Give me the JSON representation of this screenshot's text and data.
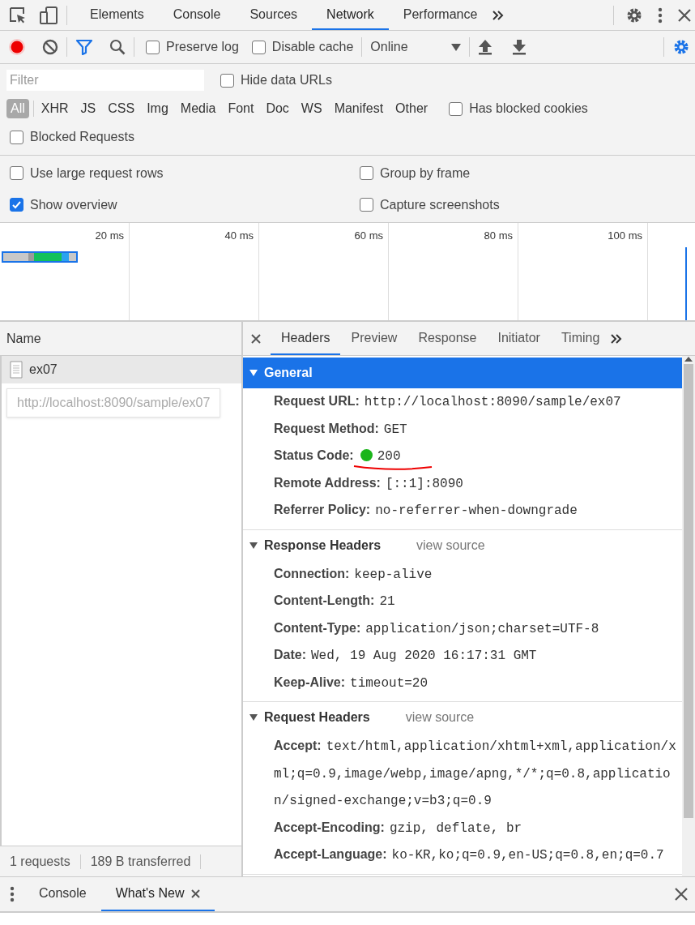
{
  "top_tabs": [
    {
      "label": "Elements",
      "selected": false
    },
    {
      "label": "Console",
      "selected": false
    },
    {
      "label": "Sources",
      "selected": false
    },
    {
      "label": "Network",
      "selected": true
    },
    {
      "label": "Performance",
      "selected": false
    }
  ],
  "toolbar": {
    "recording": true,
    "filter_active": true,
    "checkboxes": [
      {
        "label": "Preserve log",
        "checked": false
      },
      {
        "label": "Disable cache",
        "checked": false
      }
    ],
    "throttle": "Online"
  },
  "filter": {
    "placeholder": "Filter",
    "hide_data_urls": {
      "label": "Hide data URLs",
      "checked": false
    }
  },
  "types": [
    {
      "label": "All",
      "selected": true
    },
    {
      "label": "XHR",
      "selected": false
    },
    {
      "label": "JS",
      "selected": false
    },
    {
      "label": "CSS",
      "selected": false
    },
    {
      "label": "Img",
      "selected": false
    },
    {
      "label": "Media",
      "selected": false
    },
    {
      "label": "Font",
      "selected": false
    },
    {
      "label": "Doc",
      "selected": false
    },
    {
      "label": "WS",
      "selected": false
    },
    {
      "label": "Manifest",
      "selected": false
    },
    {
      "label": "Other",
      "selected": false
    }
  ],
  "has_blocked_cookies": {
    "label": "Has blocked cookies",
    "checked": false
  },
  "blocked_requests": {
    "label": "Blocked Requests",
    "checked": false
  },
  "settings": [
    {
      "label": "Use large request rows",
      "checked": false
    },
    {
      "label": "Group by frame",
      "checked": false
    },
    {
      "label": "Show overview",
      "checked": true
    },
    {
      "label": "Capture screenshots",
      "checked": false
    }
  ],
  "overview": {
    "ticks": [
      "20 ms",
      "40 ms",
      "60 ms",
      "80 ms",
      "100 ms"
    ]
  },
  "requests": {
    "column": "Name",
    "rows": [
      {
        "name": "ex07",
        "selected": true
      }
    ],
    "tooltip": "http://localhost:8090/sample/ex07"
  },
  "detail_tabs": [
    {
      "label": "Headers",
      "selected": true
    },
    {
      "label": "Preview",
      "selected": false
    },
    {
      "label": "Response",
      "selected": false
    },
    {
      "label": "Initiator",
      "selected": false
    },
    {
      "label": "Timing",
      "selected": false
    }
  ],
  "sections": [
    {
      "title": "General",
      "expanded": true,
      "highlighted": true,
      "rows": [
        {
          "key": "Request URL:",
          "value": "http://localhost:8090/sample/ex07"
        },
        {
          "key": "Request Method:",
          "value": "GET"
        },
        {
          "key": "Status Code:",
          "value": "200",
          "kind": "status",
          "underlined": true
        },
        {
          "key": "Remote Address:",
          "value": "[::1]:8090"
        },
        {
          "key": "Referrer Policy:",
          "value": "no-referrer-when-downgrade"
        }
      ]
    },
    {
      "title": "Response Headers",
      "link": "view source",
      "expanded": true,
      "highlighted": false,
      "rows": [
        {
          "key": "Connection:",
          "value": "keep-alive"
        },
        {
          "key": "Content-Length:",
          "value": "21"
        },
        {
          "key": "Content-Type:",
          "value": "application/json;charset=UTF-8"
        },
        {
          "key": "Date:",
          "value": "Wed, 19 Aug 2020 16:17:31 GMT"
        },
        {
          "key": "Keep-Alive:",
          "value": "timeout=20"
        }
      ]
    },
    {
      "title": "Request Headers",
      "link": "view source",
      "expanded": true,
      "highlighted": false,
      "rows": [
        {
          "key": "Accept:",
          "value": "text/html,application/xhtml+xml,application/xml;q=0.9,image/webp,image/apng,*/*;q=0.8,application/signed-exchange;v=b3;q=0.9"
        },
        {
          "key": "Accept-Encoding:",
          "value": "gzip, deflate, br"
        },
        {
          "key": "Accept-Language:",
          "value": "ko-KR,ko;q=0.9,en-US;q=0.8,en;q=0.7"
        }
      ]
    }
  ],
  "status_bar": [
    "1 requests",
    "189 B transferred"
  ],
  "drawer_tabs": [
    {
      "label": "Console",
      "selected": false,
      "closable": false
    },
    {
      "label": "What's New",
      "selected": true,
      "closable": true
    }
  ]
}
